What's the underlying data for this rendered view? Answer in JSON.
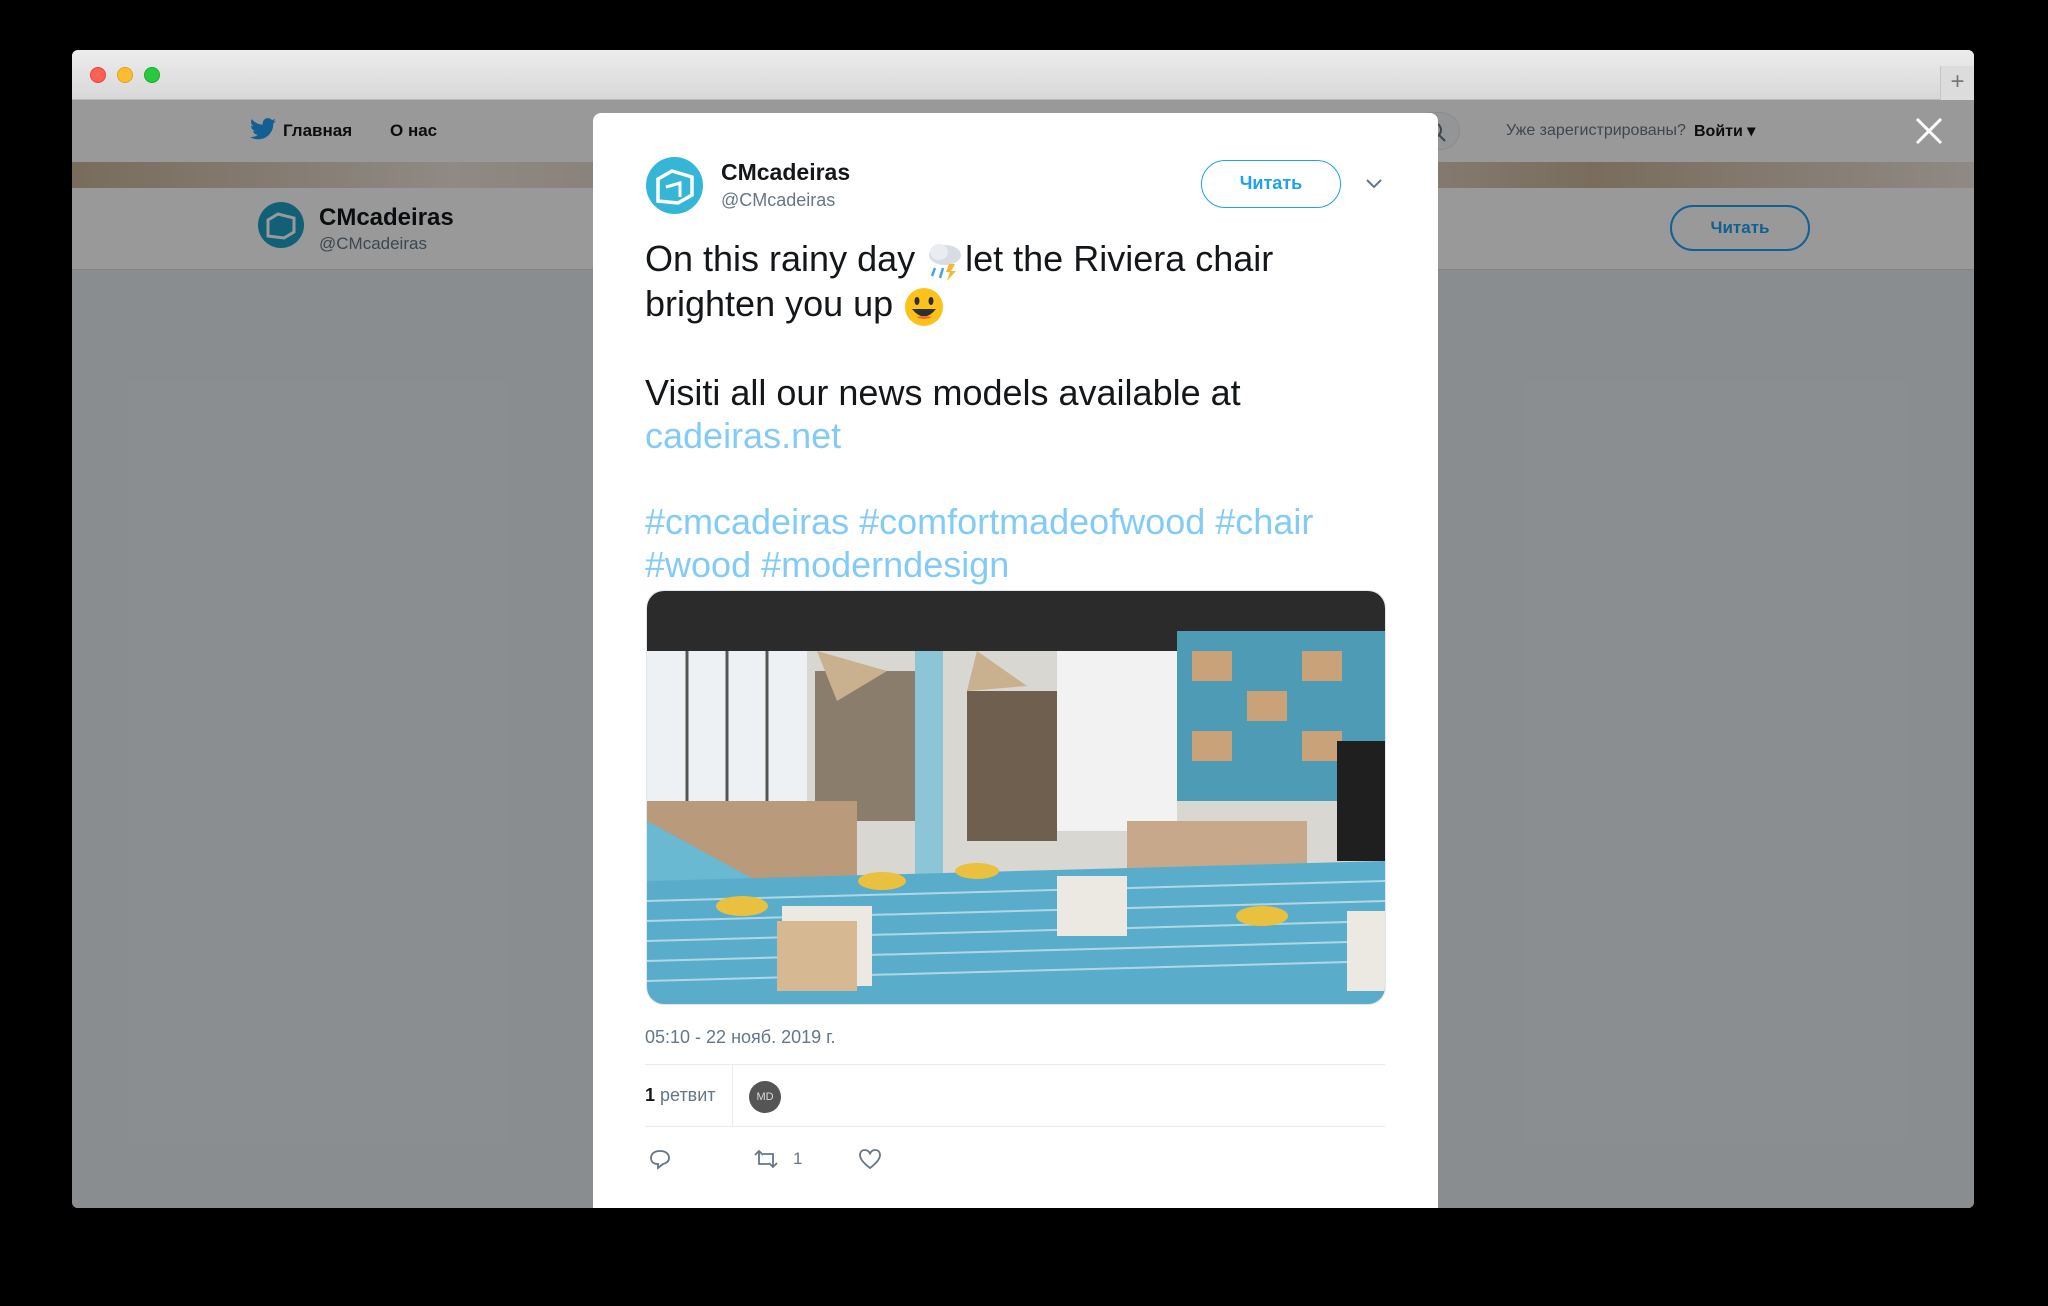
{
  "background_page": {
    "nav": {
      "home": "Главная",
      "about": "О нас",
      "login_question": "Уже зарегистрированы?",
      "login": "Войти ▾"
    },
    "profile": {
      "name": "CMcadeiras",
      "handle": "@CMcadeiras",
      "follow": "Читать"
    }
  },
  "tweet": {
    "author_name": "CMcadeiras",
    "author_handle": "@CMcadeiras",
    "follow_label": "Читать",
    "line1": "On this rainy day ",
    "line1b": "let the Riviera chair",
    "line2": "brighten you up ",
    "line3": "Visiti all our news models available at",
    "link": "cadeiras.net",
    "hashtags1": "#cmcadeiras #comfortmadeofwood #chair",
    "hashtags2": "#wood #moderndesign",
    "timestamp": "05:10 - 22 нояб. 2019 г.",
    "retweet_count": "1",
    "retweet_label": " ретвит",
    "retweeter_initials": "MD",
    "retweet_action_count": "1"
  },
  "colors": {
    "accent": "#1da1f2",
    "text": "#14171a",
    "muted": "#657786"
  },
  "icons": [
    "close-icon",
    "caret-down-icon",
    "reply-icon",
    "retweet-icon",
    "like-icon",
    "search-icon",
    "twitter-bird-icon"
  ]
}
